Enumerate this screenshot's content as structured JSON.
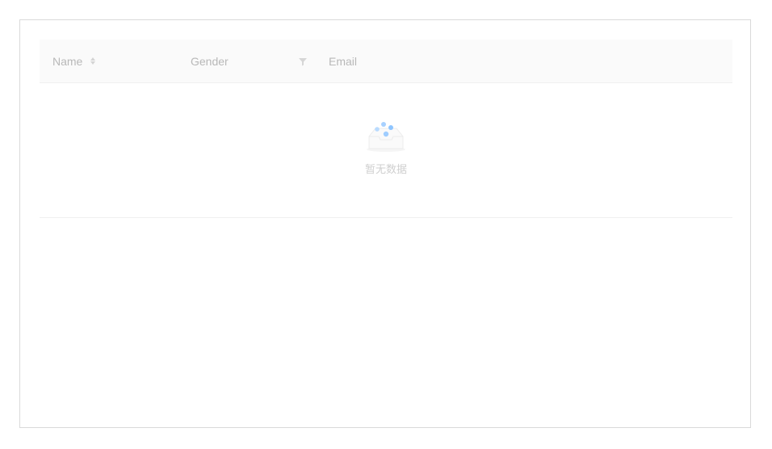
{
  "table": {
    "columns": [
      {
        "label": "Name",
        "sortable": true
      },
      {
        "label": "Gender",
        "filterable": true
      },
      {
        "label": "Email"
      }
    ],
    "empty_text": "暂无数据",
    "empty_icon": "empty-box-icon"
  },
  "colors": {
    "header_bg": "#fafafa",
    "header_text": "#b8b8b8",
    "border": "#f0f0f0",
    "frame_border": "#d9d9d9",
    "empty_dots": "#8ec5ff"
  }
}
